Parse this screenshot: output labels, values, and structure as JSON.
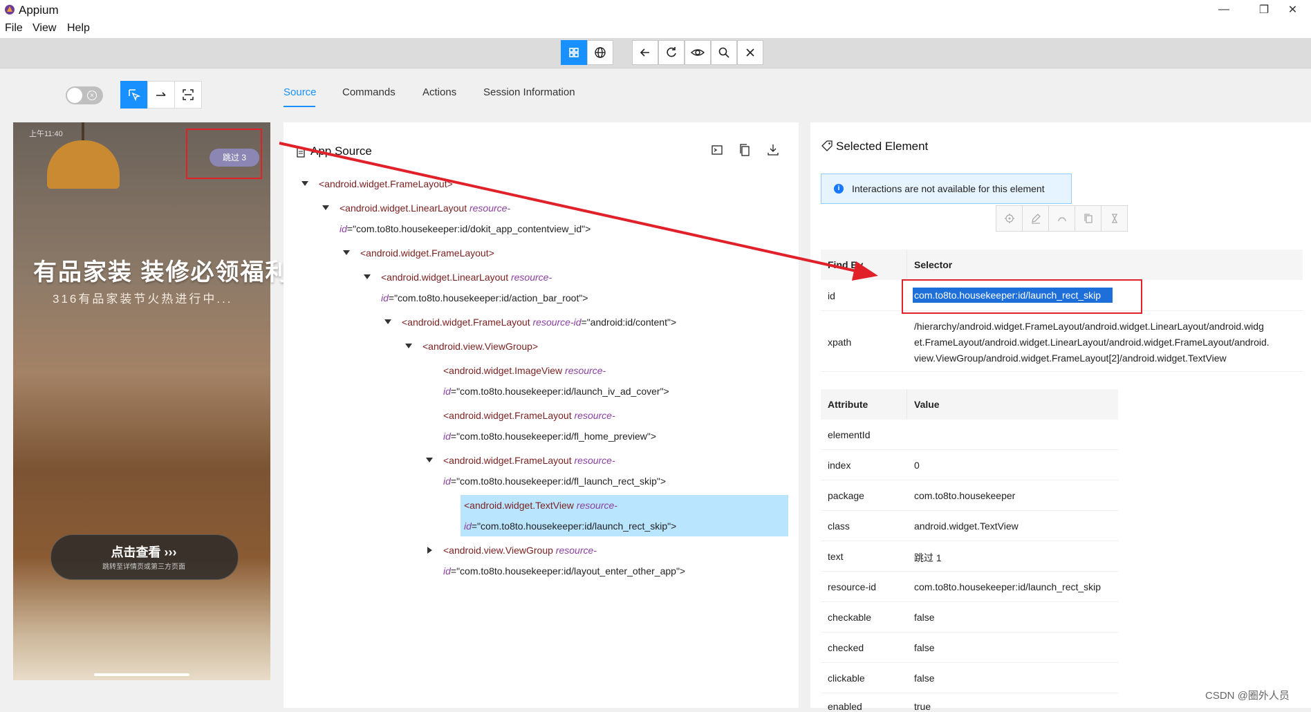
{
  "window": {
    "title": "Appium",
    "controls": {
      "minimize": "—",
      "restore": "❐",
      "close": "✕"
    }
  },
  "menu": [
    "File",
    "View",
    "Help"
  ],
  "tabs": [
    "Source",
    "Commands",
    "Actions",
    "Session Information"
  ],
  "active_tab": "Source",
  "phone": {
    "status_time": "上午11:40",
    "skip_label": "跳过 3",
    "headline": "有品家装  装修必领福利",
    "subline": "316有品家装节火热进行中...",
    "cta": "点击查看 ›››",
    "cta_sub": "跳转至详情页或第三方页面"
  },
  "app_source": {
    "title": "App Source",
    "nodes": [
      {
        "tag": "<android.widget.FrameLayout>"
      },
      {
        "tag": "<android.widget.LinearLayout",
        "attr": "resource-",
        "attr2": "id",
        "value": "=\"com.to8to.housekeeper:id/dokit_app_contentview_id\">"
      },
      {
        "tag": "<android.widget.FrameLayout>"
      },
      {
        "tag": "<android.widget.LinearLayout",
        "attr": "resource-",
        "attr2": "id",
        "value": "=\"com.to8to.housekeeper:id/action_bar_root\">"
      },
      {
        "tag": "<android.widget.FrameLayout",
        "attr": "resource-id",
        "value": "=\"android:id/content\">"
      },
      {
        "tag": "<android.view.ViewGroup>"
      },
      {
        "tag": "<android.widget.ImageView",
        "attr": "resource-",
        "attr2": "id",
        "value": "=\"com.to8to.housekeeper:id/launch_iv_ad_cover\">"
      },
      {
        "tag": "<android.widget.FrameLayout",
        "attr": "resource-",
        "attr2": "id",
        "value": "=\"com.to8to.housekeeper:id/fl_home_preview\">"
      },
      {
        "tag": "<android.widget.FrameLayout",
        "attr": "resource-",
        "attr2": "id",
        "value": "=\"com.to8to.housekeeper:id/fl_launch_rect_skip\">"
      },
      {
        "tag": "<android.widget.TextView",
        "attr": "resource-",
        "attr2": "id",
        "value": "=\"com.to8to.housekeeper:id/launch_rect_skip\">"
      },
      {
        "tag": "<android.view.ViewGroup",
        "attr": "resource-",
        "attr2": "id",
        "value": "=\"com.to8to.housekeeper:id/layout_enter_other_app\">"
      }
    ]
  },
  "selected": {
    "title": "Selected Element",
    "alert": "Interactions are not available for this element",
    "find_by_header": "Find By",
    "selector_header": "Selector",
    "find_rows": [
      {
        "by": "id",
        "selector": "com.to8to.housekeeper:id/launch_rect_skip"
      },
      {
        "by": "xpath",
        "selector_lines": [
          "/hierarchy/android.widget.FrameLayout/android.widget.LinearLayout/android.widg",
          "et.FrameLayout/android.widget.LinearLayout/android.widget.FrameLayout/android.",
          "view.ViewGroup/android.widget.FrameLayout[2]/android.widget.TextView"
        ]
      }
    ],
    "attr_header": "Attribute",
    "value_header": "Value",
    "attributes": [
      {
        "name": "elementId",
        "value": ""
      },
      {
        "name": "index",
        "value": "0"
      },
      {
        "name": "package",
        "value": "com.to8to.housekeeper"
      },
      {
        "name": "class",
        "value": "android.widget.TextView"
      },
      {
        "name": "text",
        "value": "跳过 1"
      },
      {
        "name": "resource-id",
        "value": "com.to8to.housekeeper:id/launch_rect_skip"
      },
      {
        "name": "checkable",
        "value": "false"
      },
      {
        "name": "checked",
        "value": "false"
      },
      {
        "name": "clickable",
        "value": "false"
      },
      {
        "name": "enabled",
        "value": "true"
      }
    ]
  },
  "watermark": "CSDN @圈外人员",
  "colors": {
    "accent": "#1890ff",
    "annotation_red": "#e0212a",
    "selection": "#b9e5ff"
  }
}
